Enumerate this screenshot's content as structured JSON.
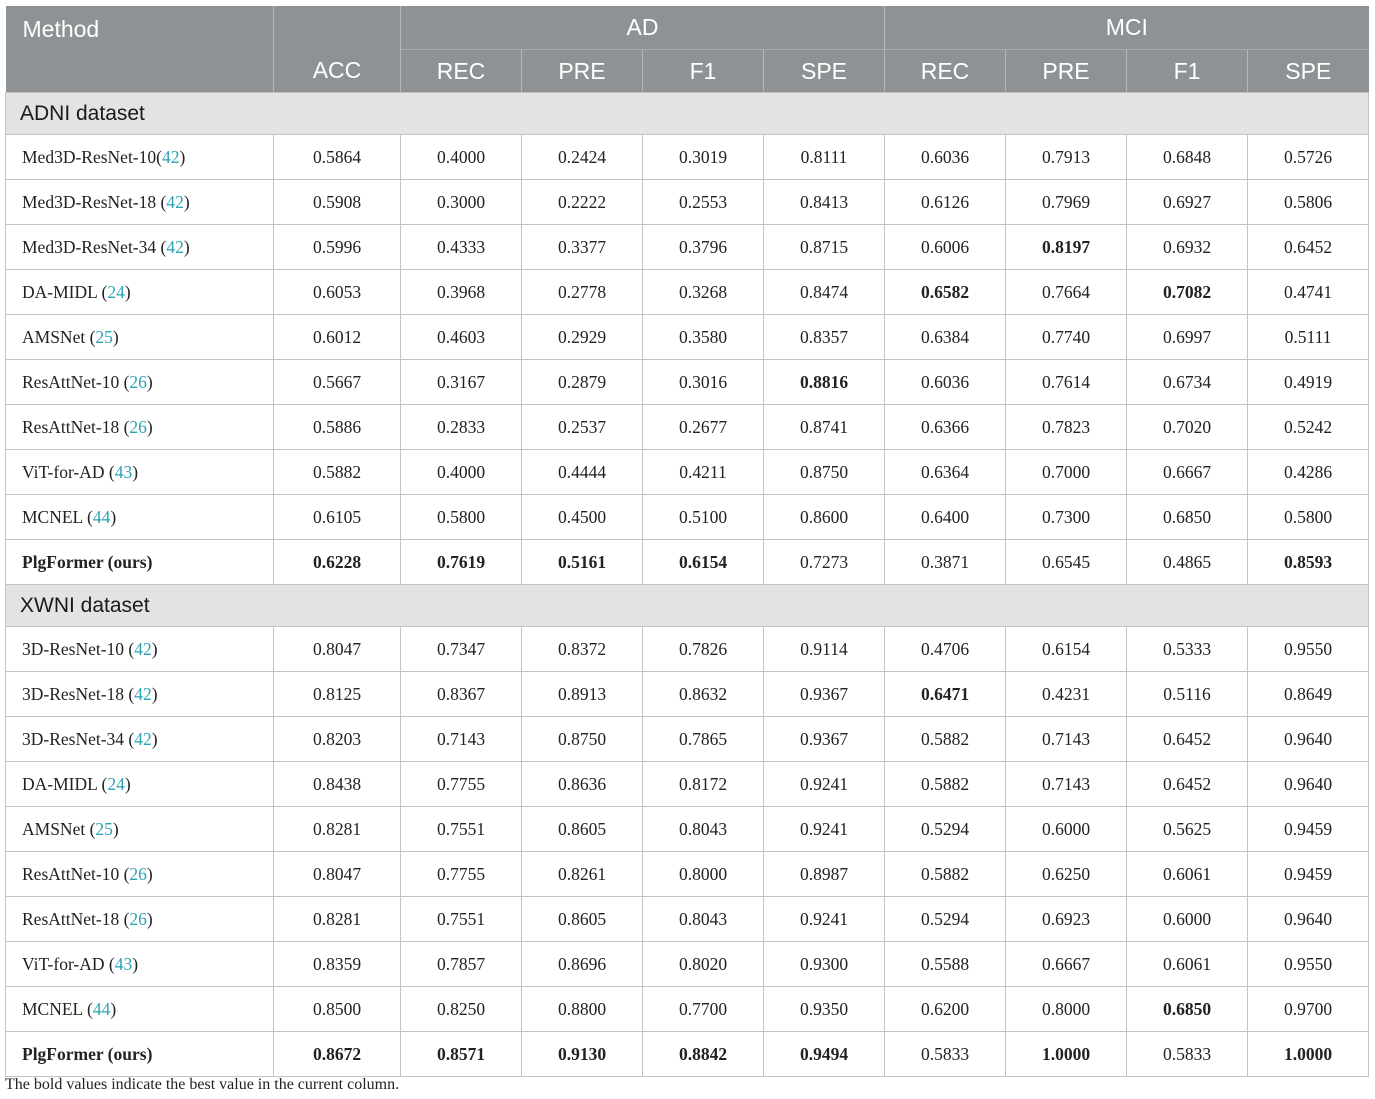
{
  "header": {
    "method": "Method",
    "acc": "ACC",
    "groups": [
      "AD",
      "MCI"
    ],
    "metrics": [
      "REC",
      "PRE",
      "F1",
      "SPE",
      "REC",
      "PRE",
      "F1",
      "SPE"
    ]
  },
  "sections": [
    {
      "title": "ADNI dataset",
      "rows": [
        {
          "name": "Med3D-ResNet-10(",
          "ref": "42",
          "values": [
            "0.5864",
            "0.4000",
            "0.2424",
            "0.3019",
            "0.8111",
            "0.6036",
            "0.7913",
            "0.6848",
            "0.5726"
          ],
          "bold": []
        },
        {
          "name": "Med3D-ResNet-18 (",
          "ref": "42",
          "values": [
            "0.5908",
            "0.3000",
            "0.2222",
            "0.2553",
            "0.8413",
            "0.6126",
            "0.7969",
            "0.6927",
            "0.5806"
          ],
          "bold": []
        },
        {
          "name": "Med3D-ResNet-34 (",
          "ref": "42",
          "values": [
            "0.5996",
            "0.4333",
            "0.3377",
            "0.3796",
            "0.8715",
            "0.6006",
            "0.8197",
            "0.6932",
            "0.6452"
          ],
          "bold": [
            6
          ]
        },
        {
          "name": "DA-MIDL (",
          "ref": "24",
          "values": [
            "0.6053",
            "0.3968",
            "0.2778",
            "0.3268",
            "0.8474",
            "0.6582",
            "0.7664",
            "0.7082",
            "0.4741"
          ],
          "bold": [
            5,
            7
          ]
        },
        {
          "name": "AMSNet (",
          "ref": "25",
          "values": [
            "0.6012",
            "0.4603",
            "0.2929",
            "0.3580",
            "0.8357",
            "0.6384",
            "0.7740",
            "0.6997",
            "0.5111"
          ],
          "bold": []
        },
        {
          "name": "ResAttNet-10 (",
          "ref": "26",
          "values": [
            "0.5667",
            "0.3167",
            "0.2879",
            "0.3016",
            "0.8816",
            "0.6036",
            "0.7614",
            "0.6734",
            "0.4919"
          ],
          "bold": [
            4
          ]
        },
        {
          "name": "ResAttNet-18 (",
          "ref": "26",
          "values": [
            "0.5886",
            "0.2833",
            "0.2537",
            "0.2677",
            "0.8741",
            "0.6366",
            "0.7823",
            "0.7020",
            "0.5242"
          ],
          "bold": []
        },
        {
          "name": "ViT-for-AD (",
          "ref": "43",
          "values": [
            "0.5882",
            "0.4000",
            "0.4444",
            "0.4211",
            "0.8750",
            "0.6364",
            "0.7000",
            "0.6667",
            "0.4286"
          ],
          "bold": []
        },
        {
          "name": "MCNEL (",
          "ref": "44",
          "values": [
            "0.6105",
            "0.5800",
            "0.4500",
            "0.5100",
            "0.8600",
            "0.6400",
            "0.7300",
            "0.6850",
            "0.5800"
          ],
          "bold": []
        },
        {
          "name": "PlgFormer (ours)",
          "ref": "",
          "nameBold": true,
          "values": [
            "0.6228",
            "0.7619",
            "0.5161",
            "0.6154",
            "0.7273",
            "0.3871",
            "0.6545",
            "0.4865",
            "0.8593"
          ],
          "bold": [
            0,
            1,
            2,
            3,
            8
          ]
        }
      ]
    },
    {
      "title": "XWNI dataset",
      "rows": [
        {
          "name": "3D-ResNet-10 (",
          "ref": "42",
          "values": [
            "0.8047",
            "0.7347",
            "0.8372",
            "0.7826",
            "0.9114",
            "0.4706",
            "0.6154",
            "0.5333",
            "0.9550"
          ],
          "bold": []
        },
        {
          "name": "3D-ResNet-18 (",
          "ref": "42",
          "values": [
            "0.8125",
            "0.8367",
            "0.8913",
            "0.8632",
            "0.9367",
            "0.6471",
            "0.4231",
            "0.5116",
            "0.8649"
          ],
          "bold": [
            5
          ]
        },
        {
          "name": "3D-ResNet-34 (",
          "ref": "42",
          "values": [
            "0.8203",
            "0.7143",
            "0.8750",
            "0.7865",
            "0.9367",
            "0.5882",
            "0.7143",
            "0.6452",
            "0.9640"
          ],
          "bold": []
        },
        {
          "name": "DA-MIDL (",
          "ref": "24",
          "values": [
            "0.8438",
            "0.7755",
            "0.8636",
            "0.8172",
            "0.9241",
            "0.5882",
            "0.7143",
            "0.6452",
            "0.9640"
          ],
          "bold": []
        },
        {
          "name": "AMSNet (",
          "ref": "25",
          "values": [
            "0.8281",
            "0.7551",
            "0.8605",
            "0.8043",
            "0.9241",
            "0.5294",
            "0.6000",
            "0.5625",
            "0.9459"
          ],
          "bold": []
        },
        {
          "name": "ResAttNet-10 (",
          "ref": "26",
          "values": [
            "0.8047",
            "0.7755",
            "0.8261",
            "0.8000",
            "0.8987",
            "0.5882",
            "0.6250",
            "0.6061",
            "0.9459"
          ],
          "bold": []
        },
        {
          "name": "ResAttNet-18 (",
          "ref": "26",
          "values": [
            "0.8281",
            "0.7551",
            "0.8605",
            "0.8043",
            "0.9241",
            "0.5294",
            "0.6923",
            "0.6000",
            "0.9640"
          ],
          "bold": []
        },
        {
          "name": "ViT-for-AD (",
          "ref": "43",
          "values": [
            "0.8359",
            "0.7857",
            "0.8696",
            "0.8020",
            "0.9300",
            "0.5588",
            "0.6667",
            "0.6061",
            "0.9550"
          ],
          "bold": []
        },
        {
          "name": "MCNEL (",
          "ref": "44",
          "values": [
            "0.8500",
            "0.8250",
            "0.8800",
            "0.7700",
            "0.9350",
            "0.6200",
            "0.8000",
            "0.6850",
            "0.9700"
          ],
          "bold": [
            7
          ]
        },
        {
          "name": "PlgFormer (ours)",
          "ref": "",
          "nameBold": true,
          "values": [
            "0.8672",
            "0.8571",
            "0.9130",
            "0.8842",
            "0.9494",
            "0.5833",
            "1.0000",
            "0.5833",
            "1.0000"
          ],
          "bold": [
            0,
            1,
            2,
            3,
            4,
            6,
            8
          ]
        }
      ]
    }
  ],
  "footnote": "The bold values indicate the best value in the current column.",
  "colors": {
    "header_bg": "#8e9294",
    "section_bg": "#e3e3e3",
    "ref_link": "#2ba3b3"
  }
}
